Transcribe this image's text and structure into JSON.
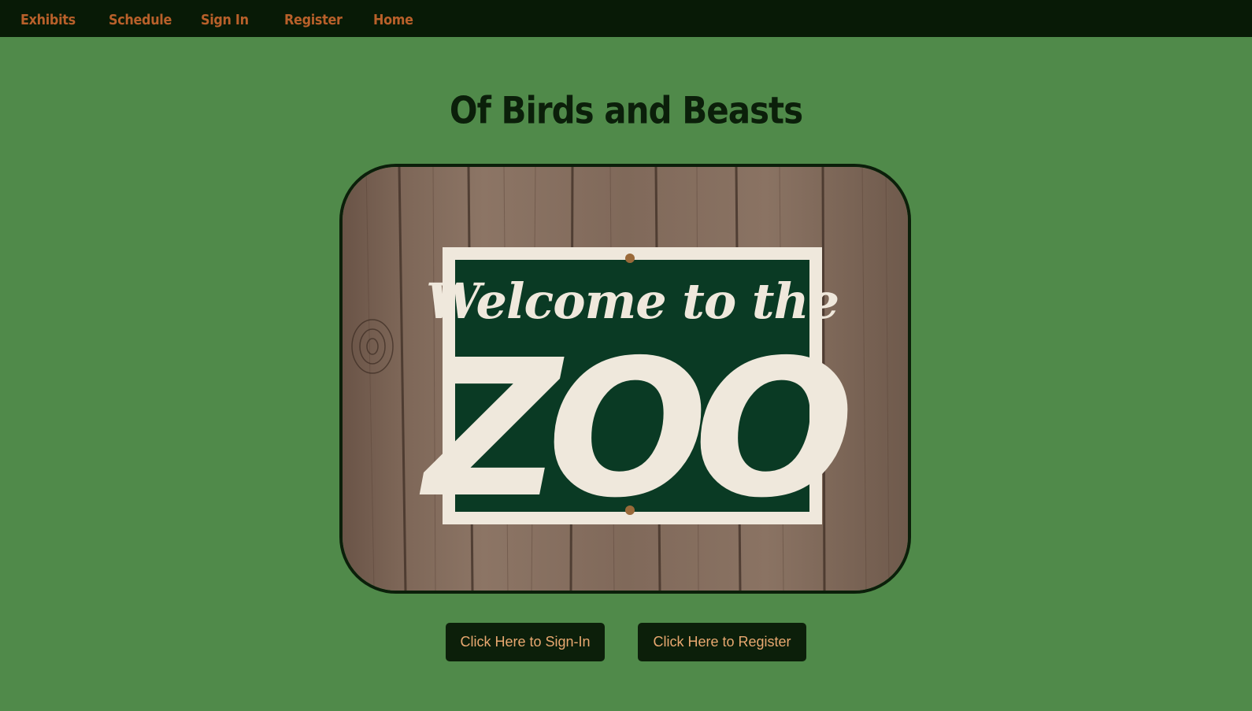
{
  "nav": {
    "items": [
      {
        "label": "Exhibits"
      },
      {
        "label": "Schedule"
      },
      {
        "label": "Sign In"
      },
      {
        "label": "Register"
      },
      {
        "label": "Home"
      }
    ]
  },
  "main": {
    "title": "Of Birds and Beasts",
    "hero_sign": {
      "line1": "Welcome to the",
      "line2": "ZOO"
    },
    "buttons": {
      "sign_in": "Click Here to Sign-In",
      "register": "Click Here to Register"
    }
  },
  "colors": {
    "page_bg": "#508a4a",
    "nav_bg": "#081a06",
    "nav_link": "#b8602a",
    "title": "#0b1f0a",
    "button_bg": "#0c1f0a",
    "button_text": "#e8a870",
    "sign_green": "#0a3a24",
    "sign_cream": "#efe8dc"
  }
}
